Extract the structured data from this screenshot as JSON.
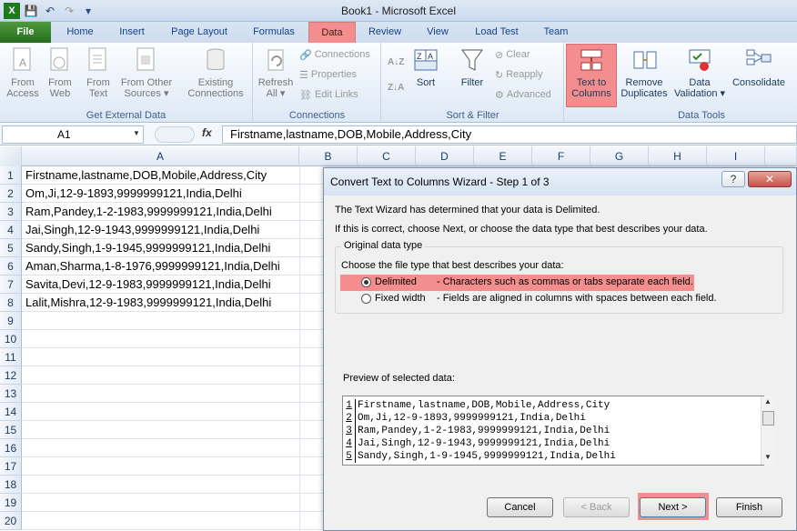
{
  "window": {
    "title": "Book1 - Microsoft Excel"
  },
  "tabs": [
    "File",
    "Home",
    "Insert",
    "Page Layout",
    "Formulas",
    "Data",
    "Review",
    "View",
    "Load Test",
    "Team"
  ],
  "ribbon": {
    "get_external": {
      "label": "Get External Data",
      "buttons": [
        [
          "From",
          "Access"
        ],
        [
          "From",
          "Web"
        ],
        [
          "From",
          "Text"
        ],
        [
          "From Other",
          "Sources ▾"
        ],
        [
          "Existing",
          "Connections"
        ]
      ]
    },
    "connections": {
      "label": "Connections",
      "refresh": [
        "Refresh",
        "All ▾"
      ],
      "items": [
        "Connections",
        "Properties",
        "Edit Links"
      ]
    },
    "sort_filter": {
      "label": "Sort & Filter",
      "sort": "Sort",
      "filter": "Filter",
      "clear": "Clear",
      "reapply": "Reapply",
      "advanced": "Advanced"
    },
    "data_tools": {
      "label": "Data Tools",
      "text_to_columns": [
        "Text to",
        "Columns"
      ],
      "remove_duplicates": [
        "Remove",
        "Duplicates"
      ],
      "data_validation": [
        "Data",
        "Validation ▾"
      ],
      "consolidate": "Consolidate"
    }
  },
  "formula_bar": {
    "name_box": "A1",
    "fx": "fx",
    "formula": "Firstname,lastname,DOB,Mobile,Address,City"
  },
  "columns": [
    "A",
    "B",
    "C",
    "D",
    "E",
    "F",
    "G",
    "H",
    "I"
  ],
  "rows": [
    "1",
    "2",
    "3",
    "4",
    "5",
    "6",
    "7",
    "8",
    "9",
    "10",
    "11",
    "12",
    "13",
    "14",
    "15",
    "16",
    "17",
    "18",
    "19",
    "20"
  ],
  "cells": [
    "Firstname,lastname,DOB,Mobile,Address,City",
    "Om,Ji,12-9-1893,9999999121,India,Delhi",
    "Ram,Pandey,1-2-1983,9999999121,India,Delhi",
    "Jai,Singh,12-9-1943,9999999121,India,Delhi",
    "Sandy,Singh,1-9-1945,9999999121,India,Delhi",
    "Aman,Sharma,1-8-1976,9999999121,India,Delhi",
    "Savita,Devi,12-9-1983,9999999121,India,Delhi",
    "Lalit,Mishra,12-9-1983,9999999121,India,Delhi"
  ],
  "dialog": {
    "title": "Convert Text to Columns Wizard - Step 1 of 3",
    "help": "?",
    "close": "✕",
    "line1": "The Text Wizard has determined that your data is Delimited.",
    "line2": "If this is correct, choose Next, or choose the data type that best describes your data.",
    "fieldset_label": "Original data type",
    "choose": "Choose the file type that best describes your data:",
    "delimited_label": "Delimited",
    "delimited_desc": "- Characters such as commas or tabs separate each field.",
    "fixed_label": "Fixed width",
    "fixed_desc": "- Fields are aligned in columns with spaces between each field.",
    "preview_label": "Preview of selected data:",
    "preview": [
      {
        "n": "1",
        "t": "Firstname,lastname,DOB,Mobile,Address,City"
      },
      {
        "n": "2",
        "t": "Om,Ji,12-9-1893,9999999121,India,Delhi"
      },
      {
        "n": "3",
        "t": "Ram,Pandey,1-2-1983,9999999121,India,Delhi"
      },
      {
        "n": "4",
        "t": "Jai,Singh,12-9-1943,9999999121,India,Delhi"
      },
      {
        "n": "5",
        "t": "Sandy,Singh,1-9-1945,9999999121,India,Delhi"
      }
    ],
    "cancel": "Cancel",
    "back": "< Back",
    "next": "Next >",
    "finish": "Finish"
  },
  "colors": {
    "highlight": "#f48d8d",
    "file_tab": "#2b7a2b"
  }
}
